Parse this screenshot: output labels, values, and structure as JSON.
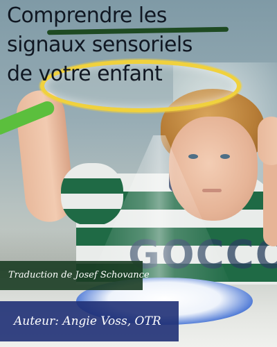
{
  "cover": {
    "title_lines": [
      "Comprendre les",
      "signaux sensoriels",
      "de votre enfant"
    ],
    "translator_credit": "Traduction de Josef Schovance",
    "author_credit": "Auteur: Angie Voss, OTR",
    "shirt_print": "GOCCO"
  },
  "colors": {
    "title_text": "#101722",
    "title_underline": "#1e4a22",
    "translator_band": "#1a3c22",
    "author_band": "#1f3076",
    "wand_ring": "#f0d13d",
    "wand_handle": "#5bbf3d",
    "shirt_green": "#1f6a45"
  }
}
